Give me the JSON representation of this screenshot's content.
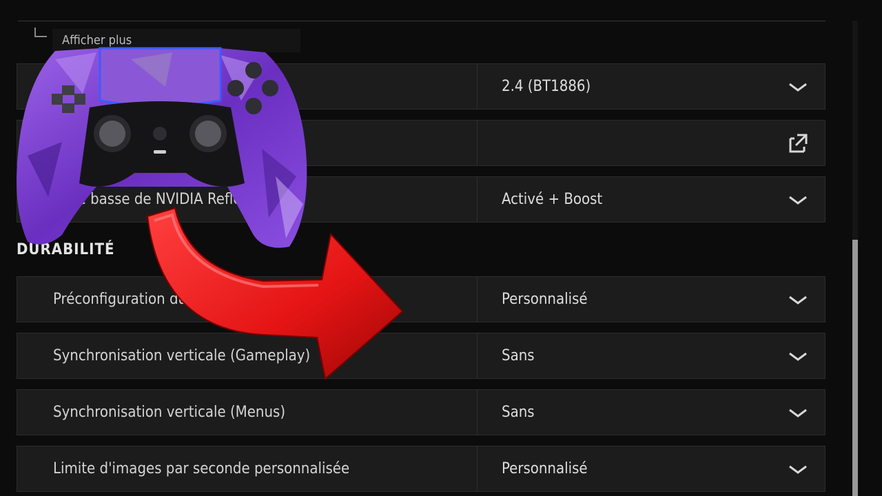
{
  "show_more": {
    "label": "Afficher plus"
  },
  "rows": [
    {
      "label": "",
      "value": "2.4 (BT1886)",
      "control": "dropdown"
    },
    {
      "label": "",
      "value": "",
      "control": "external"
    },
    {
      "label": "ence basse de NVIDIA Refle",
      "value": "Activé + Boost",
      "control": "dropdown"
    },
    {
      "label": "Préconfiguration du r",
      "value": "Personnalisé",
      "control": "dropdown"
    },
    {
      "label": "Synchronisation verticale (Gameplay)",
      "value": "Sans",
      "control": "dropdown"
    },
    {
      "label": "Synchronisation verticale (Menus)",
      "value": "Sans",
      "control": "dropdown"
    },
    {
      "label": "Limite d'images par seconde personnalisée",
      "value": "Personnalisé",
      "control": "dropdown"
    }
  ],
  "section": {
    "title": "DURABILITÉ"
  },
  "colors": {
    "controller_purple": "#7b3fd0",
    "arrow_red": "#e81b1b",
    "background": "#0c0c0c",
    "row_background": "#1c1c1c"
  },
  "icons": {
    "dropdown": "chevron-down-icon",
    "external": "external-link-icon"
  }
}
